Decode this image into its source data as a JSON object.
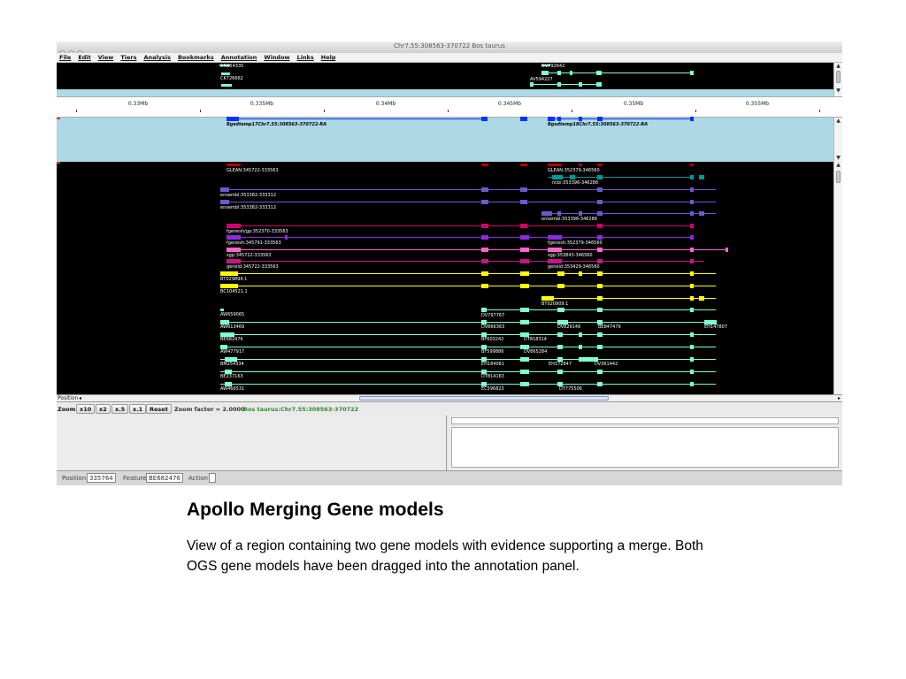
{
  "window": {
    "title": "Chr7.55:308563-370722 Bos taurus"
  },
  "menu": [
    "File",
    "Edit",
    "View",
    "Tiers",
    "Analysis",
    "Bookmarks",
    "Annotation",
    "Window",
    "Links",
    "Help"
  ],
  "overview_labels": [
    "CN654335",
    "CK726662",
    "DV792642",
    "AV594227"
  ],
  "ruler_ticks": [
    "0.33Mb",
    "0.335Mb",
    "0.34Mb",
    "0.345Mb",
    "0.35Mb",
    "0.355Mb"
  ],
  "annotation_models": [
    "Bgsdtemp17Chr7.55:308563-370722-RA",
    "Bgsdtemp18Chr7.55:308563-370722-RA"
  ],
  "evidence_labels": {
    "left": [
      "GLEAN:345722-333563",
      "ensembl:353382-333312",
      "ensembl:353382-333312",
      "fgenesh/gp:352370-333563",
      "fgenesh:345791-333563",
      "sgp:345722-333563",
      "geneid:345722-333563",
      "BT029894.1",
      "BC104521.1",
      "AW659065",
      "AW613469",
      "BE682476",
      "AW477917",
      "BM254334",
      "BE237163",
      "AW466531"
    ],
    "middle": [
      "DV797767",
      "DV866363",
      "BF603242",
      "DT818314",
      "BF599886",
      "DV865284",
      "EH184061",
      "DT814163",
      "EC596823"
    ],
    "right_top": [
      "GLEAN:352379-346560",
      "ncbi:353396-346286",
      "ensembl:353396-346286",
      "fgenesh:352379-346560",
      "sgp:353843-346560",
      "geneid:353429-346560",
      "BT020909.1",
      "DV829146",
      "EH172847",
      "DV361442",
      "DT775506"
    ],
    "far_right": [
      "BE847479",
      "EH147807"
    ]
  },
  "position_bar": {
    "label": "Position"
  },
  "zoom": {
    "label": "Zoom",
    "buttons": [
      "x10",
      "x2",
      "x.5",
      "x.1",
      "Reset"
    ],
    "factor": "Zoom factor = 2.0000",
    "location": "Bos taurus:Chr7.55:308563-370722"
  },
  "status": {
    "position_label": "Position",
    "position_value": "335764",
    "feature_label": "Feature",
    "feature_value": "BE682476",
    "action_label": "Action",
    "action_value": ""
  },
  "slide": {
    "title": "Apollo Merging Gene models",
    "body": "View of a region containing two gene models with evidence supporting a merge.  Both OGS gene models have been dragged into the annotation panel."
  },
  "colors": {
    "track_black": "#000000",
    "annotation_blue": "#add8e6",
    "model_blue": "#0033ff",
    "glean_red": "#b00000",
    "ensembl_purple": "#6a5acd",
    "fgenesh_magenta": "#d1006f",
    "sgp_pink": "#ff66cc",
    "est_cyan": "#7fffd4",
    "cdna_yellow": "#ffff00",
    "ncbi_teal": "#009999"
  }
}
